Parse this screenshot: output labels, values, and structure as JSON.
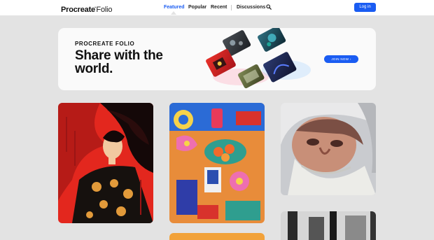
{
  "header": {
    "logo": {
      "part1": "Procreate",
      "part2": "Folio"
    },
    "nav": [
      {
        "label": "Featured",
        "active": true
      },
      {
        "label": "Popular",
        "active": false
      },
      {
        "label": "Recent",
        "active": false
      },
      {
        "label": "Discussions",
        "active": false
      }
    ],
    "search_icon": "search-icon",
    "login_label": "Log in"
  },
  "banner": {
    "kicker": "PROCREATE FOLIO",
    "title": "Share with the world.",
    "button_label": "JOIN NOW"
  },
  "colors": {
    "accent": "#1a5cf2",
    "background": "#e3e3e3",
    "card": "#fafafa"
  }
}
